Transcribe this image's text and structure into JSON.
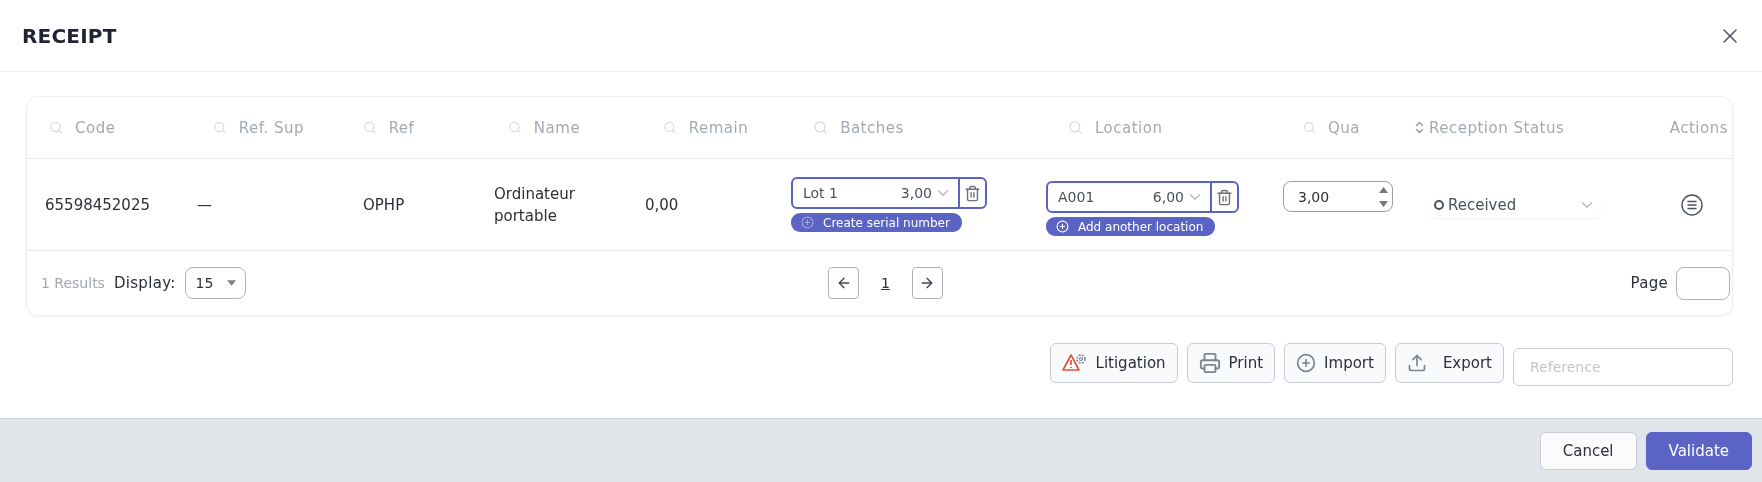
{
  "dialog": {
    "title": "RECEIPT"
  },
  "table": {
    "columns": [
      {
        "kind": "search",
        "placeholder": "Code"
      },
      {
        "kind": "search",
        "placeholder": "Ref. Sup"
      },
      {
        "kind": "search",
        "placeholder": "Ref"
      },
      {
        "kind": "search",
        "placeholder": "Name"
      },
      {
        "kind": "search",
        "placeholder": "Remain"
      },
      {
        "kind": "search",
        "placeholder": "Batches"
      },
      {
        "kind": "search",
        "placeholder": "Location"
      },
      {
        "kind": "search",
        "placeholder": "Qua"
      },
      {
        "kind": "sort",
        "label": "Reception Status"
      },
      {
        "kind": "plain",
        "label": "Actions"
      }
    ],
    "rows": [
      {
        "code": "65598452025",
        "ref_sup": "—",
        "ref": "OPHP",
        "name": "Ordinateur portable",
        "remain": "0,00",
        "batch": {
          "value": "Lot 1",
          "quantity": "3,00",
          "action": "Create serial number"
        },
        "location": {
          "value": "A001",
          "quantity": "6,00",
          "action": "Add another location"
        },
        "quantity": "3,00",
        "status": "Received"
      }
    ]
  },
  "pagination": {
    "results": "1 Results",
    "display_label": "Display:",
    "display_value": "15",
    "page": "1",
    "page_label": "Page"
  },
  "actions": [
    {
      "kind": "litigation",
      "label": "Litigation"
    },
    {
      "kind": "print",
      "label": "Print"
    },
    {
      "kind": "import",
      "label": "Import"
    },
    {
      "kind": "export",
      "label": "Export"
    }
  ],
  "reference": {
    "placeholder": "Reference"
  },
  "footer_buttons": [
    {
      "label": "Cancel",
      "primary": false
    },
    {
      "label": "Validate",
      "primary": true
    }
  ]
}
